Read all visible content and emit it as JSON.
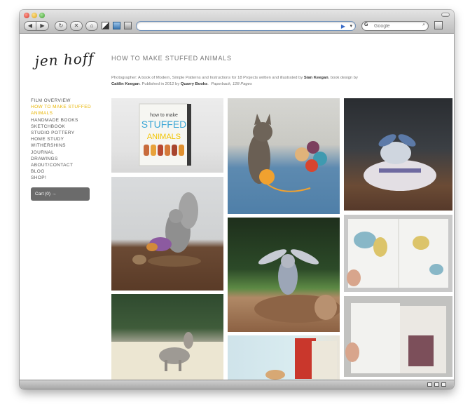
{
  "browser": {
    "url": "",
    "search_placeholder": "Google",
    "search_engine_glyph": "G",
    "back_glyph": "◀",
    "forward_glyph": "▶",
    "reload_glyph": "↻",
    "stop_glyph": "✕",
    "home_glyph": "⌂",
    "go_glyph": "▶",
    "dropdown_glyph": "▾",
    "search_glyph": "⌕"
  },
  "site": {
    "logo": "jen hoff",
    "nav": [
      {
        "label": "FILM OVERVIEW",
        "active": false
      },
      {
        "label": "HOW TO MAKE STUFFED ANIMALS",
        "active": true
      },
      {
        "label": "HANDMADE BOOKS",
        "active": false
      },
      {
        "label": "SKETCHBOOK",
        "active": false
      },
      {
        "label": "STUDIO POTTERY",
        "active": false
      },
      {
        "label": "HOME STUDY",
        "active": false
      },
      {
        "label": "WITHERSHINS",
        "active": false
      },
      {
        "label": "JOURNAL",
        "active": false
      },
      {
        "label": "DRAWINGS",
        "active": false
      },
      {
        "label": "ABOUT/CONTACT",
        "active": false
      },
      {
        "label": "BLOG",
        "active": false
      },
      {
        "label": "SHOP!",
        "active": false
      }
    ],
    "cart": "Cart (0) →",
    "accent_color": "#e8b400"
  },
  "main": {
    "title": "HOW TO MAKE STUFFED ANIMALS",
    "description": {
      "p1": "Photographer: A book of Modern, Simple Patterns and Instructions for 18 Projects written and illustrated by ",
      "author": "Sian Keegan",
      "p2": ", book design by",
      "designer": "Caitlin Keegan",
      "p3": ". Published in 2012 by ",
      "publisher": "Quarry Books",
      "p4": ".",
      "format": "Paperback, 128 Pages"
    },
    "book_cover": {
      "line1": "how to make",
      "line2": "STUFFED",
      "line3": "ANIMALS"
    }
  }
}
